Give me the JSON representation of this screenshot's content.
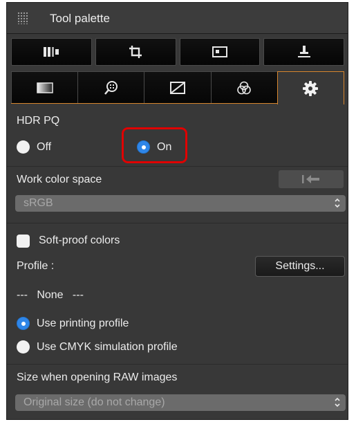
{
  "palette": {
    "title": "Tool palette",
    "tool_buttons": [
      {
        "icon": "adjust-icon"
      },
      {
        "icon": "crop-icon"
      },
      {
        "icon": "image-frame-icon"
      },
      {
        "icon": "stamp-icon"
      }
    ],
    "tabs": [
      {
        "icon": "gradient-icon",
        "active": false
      },
      {
        "icon": "zoom-detail-icon",
        "active": false
      },
      {
        "icon": "tone-curve-icon",
        "active": false
      },
      {
        "icon": "color-circles-icon",
        "active": false
      },
      {
        "icon": "gear-icon",
        "active": true
      }
    ],
    "hdr_pq": {
      "label": "HDR PQ",
      "options": [
        {
          "label": "Off",
          "selected": false
        },
        {
          "label": "On",
          "selected": true
        }
      ]
    },
    "work_color_space": {
      "label": "Work color space",
      "value": "sRGB"
    },
    "soft_proof": {
      "checkbox_label": "Soft-proof colors",
      "checked": false,
      "profile_label": "Profile :",
      "settings_label": "Settings...",
      "profile_value": "---   None   ---",
      "options": [
        {
          "label": "Use printing profile",
          "selected": true
        },
        {
          "label": "Use CMYK simulation profile",
          "selected": false
        }
      ]
    },
    "raw_size": {
      "label": "Size when opening RAW images",
      "value": "Original size (do not change)"
    }
  },
  "colors": {
    "background": "#383838",
    "accent": "#d7852d",
    "radio_selected": "#2f86e8",
    "highlight": "#e00000"
  }
}
